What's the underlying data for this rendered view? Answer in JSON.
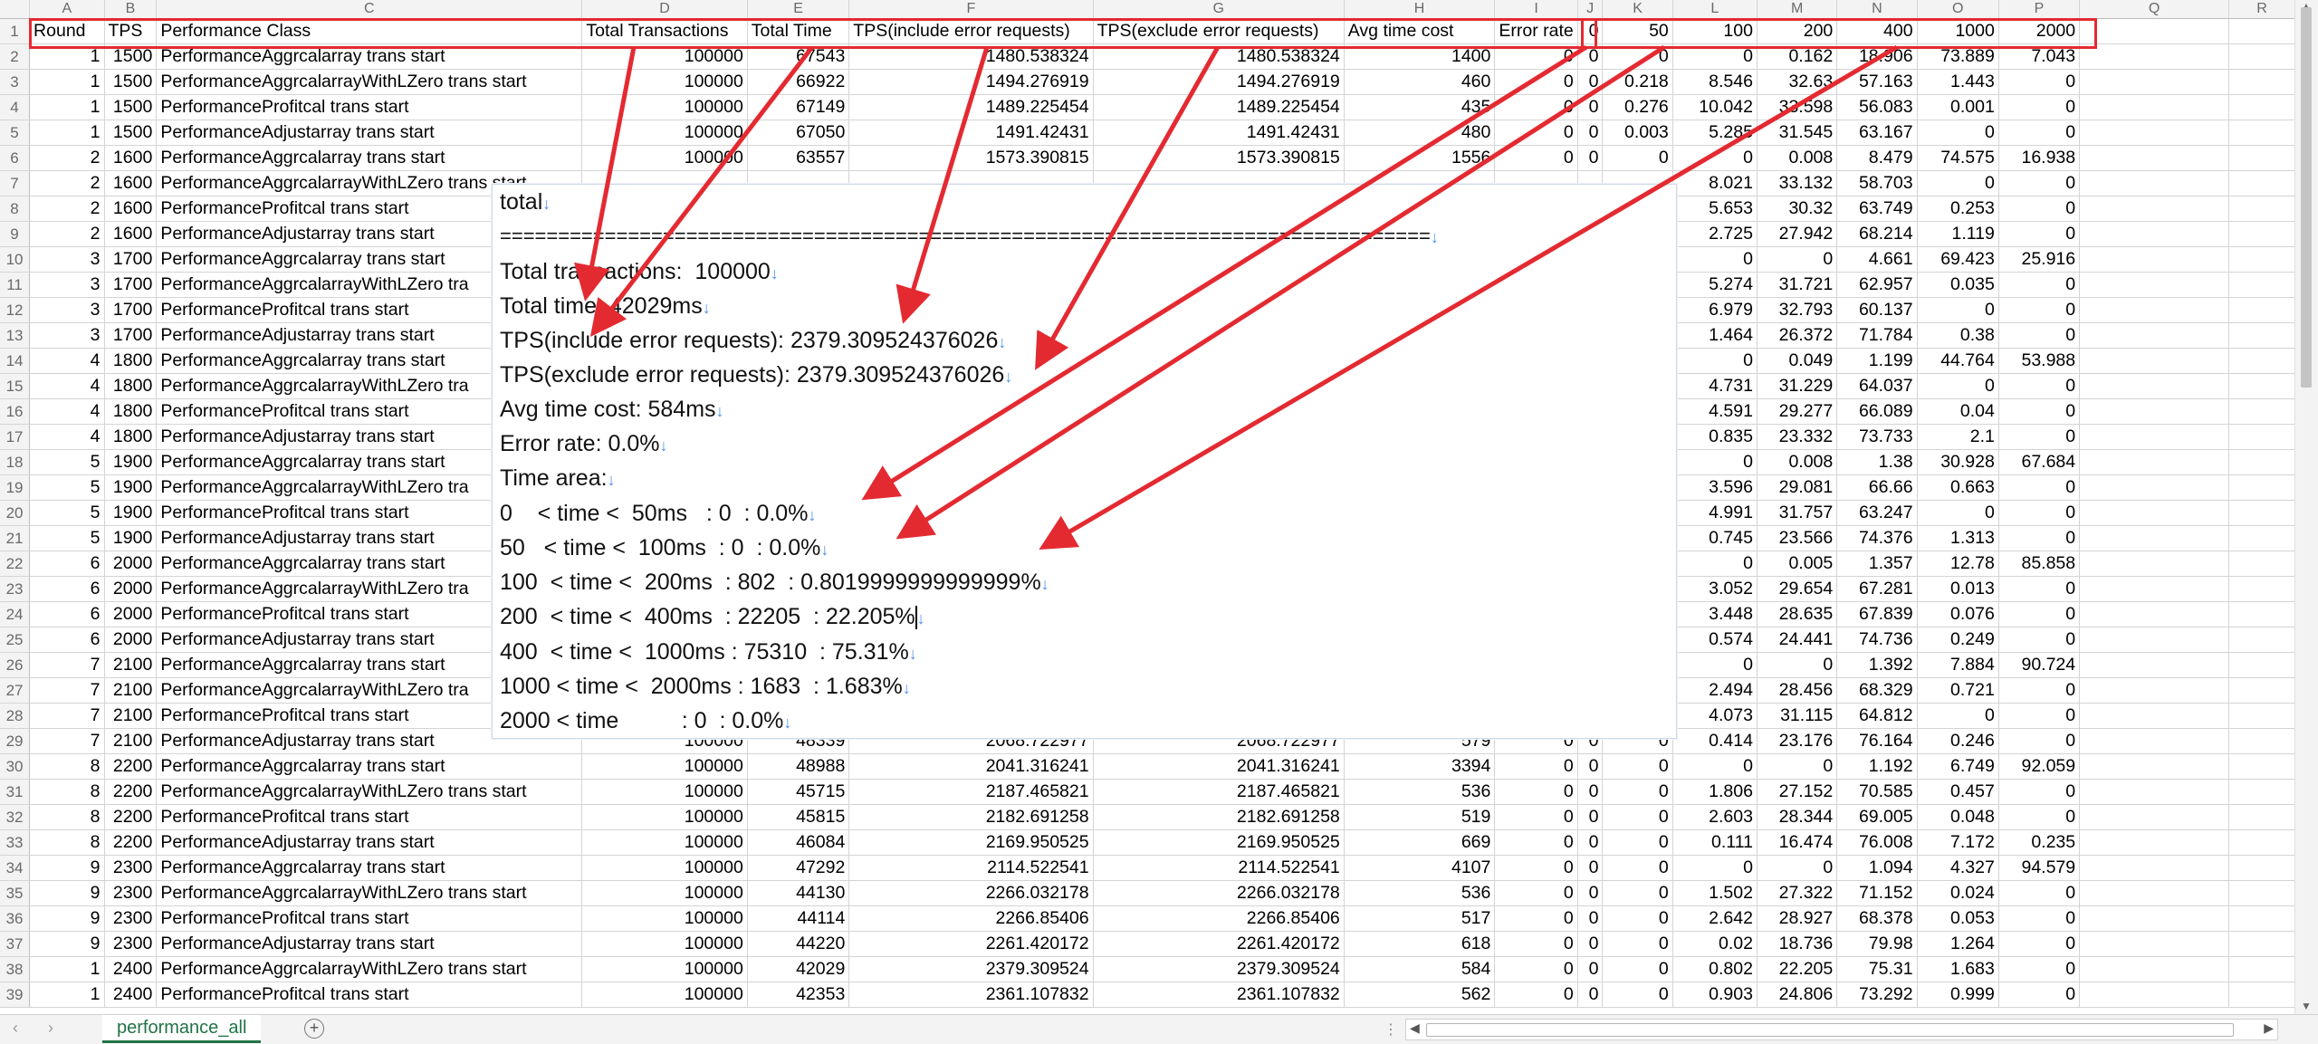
{
  "sheet": {
    "column_letters": [
      "A",
      "B",
      "C",
      "D",
      "E",
      "F",
      "G",
      "H",
      "I",
      "J",
      "K",
      "L",
      "M",
      "N",
      "O",
      "P",
      "Q",
      "R"
    ],
    "header_row": [
      "Round",
      "TPS",
      "Performance Class",
      "Total Transactions",
      "Total Time",
      "TPS(include error requests)",
      "TPS(exclude error requests)",
      "Avg time cost",
      "Error rate",
      "0",
      "50",
      "100",
      "200",
      "400",
      "1000",
      "2000"
    ],
    "rows": [
      [
        "1",
        "1500",
        "PerformanceAggrcalarray trans start",
        "100000",
        "67543",
        "1480.538324",
        "1480.538324",
        "1400",
        "0",
        "0",
        "0",
        "0",
        "0.162",
        "18.906",
        "73.889",
        "7.043"
      ],
      [
        "1",
        "1500",
        "PerformanceAggrcalarrayWithLZero trans start",
        "100000",
        "66922",
        "1494.276919",
        "1494.276919",
        "460",
        "0",
        "0",
        "0.218",
        "8.546",
        "32.63",
        "57.163",
        "1.443",
        "0"
      ],
      [
        "1",
        "1500",
        "PerformanceProfitcal trans start",
        "100000",
        "67149",
        "1489.225454",
        "1489.225454",
        "435",
        "0",
        "0",
        "0.276",
        "10.042",
        "33.598",
        "56.083",
        "0.001",
        "0"
      ],
      [
        "1",
        "1500",
        "PerformanceAdjustarray trans start",
        "100000",
        "67050",
        "1491.42431",
        "1491.42431",
        "480",
        "0",
        "0",
        "0.003",
        "5.285",
        "31.545",
        "63.167",
        "0",
        "0"
      ],
      [
        "2",
        "1600",
        "PerformanceAggrcalarray trans start",
        "100000",
        "63557",
        "1573.390815",
        "1573.390815",
        "1556",
        "0",
        "0",
        "0",
        "0",
        "0.008",
        "8.479",
        "74.575",
        "16.938"
      ],
      [
        "2",
        "1600",
        "PerformanceAggrcalarrayWithLZero trans start",
        "",
        "",
        "",
        "",
        "",
        "",
        "",
        "",
        "8.021",
        "33.132",
        "58.703",
        "0",
        "0"
      ],
      [
        "2",
        "1600",
        "PerformanceProfitcal trans start",
        "",
        "",
        "",
        "",
        "",
        "",
        "",
        "",
        "5.653",
        "30.32",
        "63.749",
        "0.253",
        "0"
      ],
      [
        "2",
        "1600",
        "PerformanceAdjustarray trans start",
        "",
        "",
        "",
        "",
        "",
        "",
        "",
        "",
        "2.725",
        "27.942",
        "68.214",
        "1.119",
        "0"
      ],
      [
        "3",
        "1700",
        "PerformanceAggrcalarray trans start",
        "",
        "",
        "",
        "",
        "",
        "",
        "",
        "",
        "0",
        "0",
        "4.661",
        "69.423",
        "25.916"
      ],
      [
        "3",
        "1700",
        "PerformanceAggrcalarrayWithLZero tra",
        "",
        "",
        "",
        "",
        "",
        "",
        "",
        "",
        "5.274",
        "31.721",
        "62.957",
        "0.035",
        "0"
      ],
      [
        "3",
        "1700",
        "PerformanceProfitcal trans start",
        "",
        "",
        "",
        "",
        "",
        "",
        "",
        "",
        "6.979",
        "32.793",
        "60.137",
        "0",
        "0"
      ],
      [
        "3",
        "1700",
        "PerformanceAdjustarray trans start",
        "",
        "",
        "",
        "",
        "",
        "",
        "",
        "",
        "1.464",
        "26.372",
        "71.784",
        "0.38",
        "0"
      ],
      [
        "4",
        "1800",
        "PerformanceAggrcalarray trans start",
        "",
        "",
        "",
        "",
        "",
        "",
        "",
        "",
        "0",
        "0.049",
        "1.199",
        "44.764",
        "53.988"
      ],
      [
        "4",
        "1800",
        "PerformanceAggrcalarrayWithLZero tra",
        "",
        "",
        "",
        "",
        "",
        "",
        "",
        "",
        "4.731",
        "31.229",
        "64.037",
        "0",
        "0"
      ],
      [
        "4",
        "1800",
        "PerformanceProfitcal trans start",
        "",
        "",
        "",
        "",
        "",
        "",
        "",
        "",
        "4.591",
        "29.277",
        "66.089",
        "0.04",
        "0"
      ],
      [
        "4",
        "1800",
        "PerformanceAdjustarray trans start",
        "",
        "",
        "",
        "",
        "",
        "",
        "",
        "",
        "0.835",
        "23.332",
        "73.733",
        "2.1",
        "0"
      ],
      [
        "5",
        "1900",
        "PerformanceAggrcalarray trans start",
        "",
        "",
        "",
        "",
        "",
        "",
        "",
        "",
        "0",
        "0.008",
        "1.38",
        "30.928",
        "67.684"
      ],
      [
        "5",
        "1900",
        "PerformanceAggrcalarrayWithLZero tra",
        "",
        "",
        "",
        "",
        "",
        "",
        "",
        "",
        "3.596",
        "29.081",
        "66.66",
        "0.663",
        "0"
      ],
      [
        "5",
        "1900",
        "PerformanceProfitcal trans start",
        "",
        "",
        "",
        "",
        "",
        "",
        "",
        "",
        "4.991",
        "31.757",
        "63.247",
        "0",
        "0"
      ],
      [
        "5",
        "1900",
        "PerformanceAdjustarray trans start",
        "",
        "",
        "",
        "",
        "",
        "",
        "",
        "",
        "0.745",
        "23.566",
        "74.376",
        "1.313",
        "0"
      ],
      [
        "6",
        "2000",
        "PerformanceAggrcalarray trans start",
        "",
        "",
        "",
        "",
        "",
        "",
        "",
        "",
        "0",
        "0.005",
        "1.357",
        "12.78",
        "85.858"
      ],
      [
        "6",
        "2000",
        "PerformanceAggrcalarrayWithLZero tra",
        "",
        "",
        "",
        "",
        "",
        "",
        "",
        "",
        "3.052",
        "29.654",
        "67.281",
        "0.013",
        "0"
      ],
      [
        "6",
        "2000",
        "PerformanceProfitcal trans start",
        "",
        "",
        "",
        "",
        "",
        "",
        "",
        "",
        "3.448",
        "28.635",
        "67.839",
        "0.076",
        "0"
      ],
      [
        "6",
        "2000",
        "PerformanceAdjustarray trans start",
        "",
        "",
        "",
        "",
        "",
        "",
        "",
        "",
        "0.574",
        "24.441",
        "74.736",
        "0.249",
        "0"
      ],
      [
        "7",
        "2100",
        "PerformanceAggrcalarray trans start",
        "",
        "",
        "",
        "",
        "",
        "",
        "",
        "",
        "0",
        "0",
        "1.392",
        "7.884",
        "90.724"
      ],
      [
        "7",
        "2100",
        "PerformanceAggrcalarrayWithLZero tra",
        "",
        "",
        "",
        "",
        "",
        "",
        "",
        "",
        "2.494",
        "28.456",
        "68.329",
        "0.721",
        "0"
      ],
      [
        "7",
        "2100",
        "PerformanceProfitcal trans start",
        "",
        "",
        "",
        "",
        "",
        "",
        "",
        "",
        "4.073",
        "31.115",
        "64.812",
        "0",
        "0"
      ],
      [
        "7",
        "2100",
        "PerformanceAdjustarray trans start",
        "100000",
        "48339",
        "2068.722977",
        "2068.722977",
        "579",
        "0",
        "0",
        "0",
        "0.414",
        "23.176",
        "76.164",
        "0.246",
        "0"
      ],
      [
        "8",
        "2200",
        "PerformanceAggrcalarray trans start",
        "100000",
        "48988",
        "2041.316241",
        "2041.316241",
        "3394",
        "0",
        "0",
        "0",
        "0",
        "0",
        "1.192",
        "6.749",
        "92.059"
      ],
      [
        "8",
        "2200",
        "PerformanceAggrcalarrayWithLZero trans start",
        "100000",
        "45715",
        "2187.465821",
        "2187.465821",
        "536",
        "0",
        "0",
        "0",
        "1.806",
        "27.152",
        "70.585",
        "0.457",
        "0"
      ],
      [
        "8",
        "2200",
        "PerformanceProfitcal trans start",
        "100000",
        "45815",
        "2182.691258",
        "2182.691258",
        "519",
        "0",
        "0",
        "0",
        "2.603",
        "28.344",
        "69.005",
        "0.048",
        "0"
      ],
      [
        "8",
        "2200",
        "PerformanceAdjustarray trans start",
        "100000",
        "46084",
        "2169.950525",
        "2169.950525",
        "669",
        "0",
        "0",
        "0",
        "0.111",
        "16.474",
        "76.008",
        "7.172",
        "0.235"
      ],
      [
        "9",
        "2300",
        "PerformanceAggrcalarray trans start",
        "100000",
        "47292",
        "2114.522541",
        "2114.522541",
        "4107",
        "0",
        "0",
        "0",
        "0",
        "0",
        "1.094",
        "4.327",
        "94.579"
      ],
      [
        "9",
        "2300",
        "PerformanceAggrcalarrayWithLZero trans start",
        "100000",
        "44130",
        "2266.032178",
        "2266.032178",
        "536",
        "0",
        "0",
        "0",
        "1.502",
        "27.322",
        "71.152",
        "0.024",
        "0"
      ],
      [
        "9",
        "2300",
        "PerformanceProfitcal trans start",
        "100000",
        "44114",
        "2266.85406",
        "2266.85406",
        "517",
        "0",
        "0",
        "0",
        "2.642",
        "28.927",
        "68.378",
        "0.053",
        "0"
      ],
      [
        "9",
        "2300",
        "PerformanceAdjustarray trans start",
        "100000",
        "44220",
        "2261.420172",
        "2261.420172",
        "618",
        "0",
        "0",
        "0",
        "0.02",
        "18.736",
        "79.98",
        "1.264",
        "0"
      ],
      [
        "1",
        "2400",
        "PerformanceAggrcalarrayWithLZero trans start",
        "100000",
        "42029",
        "2379.309524",
        "2379.309524",
        "584",
        "0",
        "0",
        "0",
        "0.802",
        "22.205",
        "75.31",
        "1.683",
        "0"
      ],
      [
        "1",
        "2400",
        "PerformanceProfitcal trans start",
        "100000",
        "42353",
        "2361.107832",
        "2361.107832",
        "562",
        "0",
        "0",
        "0",
        "0.903",
        "24.806",
        "73.292",
        "0.999",
        "0"
      ]
    ],
    "partial_right_digits": [
      "0",
      "5",
      "1",
      "0",
      "1",
      "0",
      "3",
      "7",
      "0",
      "5",
      "3",
      "0",
      "0",
      "5",
      "0",
      "0",
      "0",
      "2",
      "2",
      "0",
      "0",
      "0",
      "0",
      "0",
      "0",
      "0",
      "0"
    ]
  },
  "popup": {
    "lines": [
      "total",
      "================================================================================",
      "Total transactions:  100000",
      "Total time: 42029ms",
      "TPS(include error requests): 2379.309524376026",
      "TPS(exclude error requests): 2379.309524376026",
      "Avg time cost: 584ms",
      "Error rate: 0.0%",
      "Time area:",
      "0    < time <  50ms   : 0  : 0.0%",
      "50   < time <  100ms  : 0  : 0.0%",
      "100  < time <  200ms  : 802  : 0.8019999999999999%",
      "200  < time <  400ms  : 22205  : 22.205%",
      "400  < time <  1000ms : 75310  : 75.31%",
      "1000 < time <  2000ms : 1683  : 1.683%",
      "2000 < time          : 0  : 0.0%"
    ],
    "line_mark": "↓"
  },
  "tabs": {
    "nav_arrows": "‹ ›",
    "active_sheet": "performance_all",
    "add_sheet_icon": "+"
  },
  "colors": {
    "annotation_red": "#e42a31",
    "sheet_tab_green": "#217346",
    "mark_blue": "#4d8fe8"
  }
}
